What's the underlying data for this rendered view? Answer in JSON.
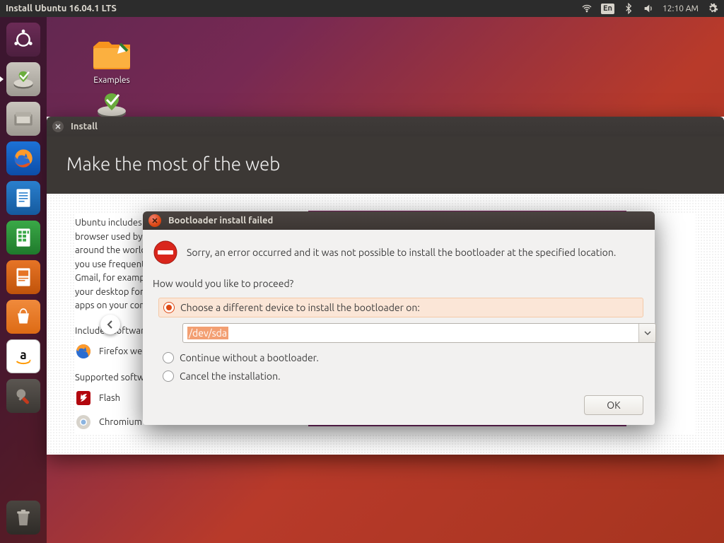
{
  "top_panel": {
    "title": "Install Ubuntu 16.04.1 LTS",
    "lang": "En",
    "clock": "12:10 AM"
  },
  "desktop": {
    "examples_label": "Examples"
  },
  "install_window": {
    "titlebar": "Install",
    "heading": "Make the most of the web",
    "blurb": "Ubuntu includes Firefox, the web browser used by millions of people around the world. And web applications you use frequently (like Facebook or Gmail, for example) can be pinned to your desktop for faster access, just like apps on your computer.",
    "included_label": "Included software",
    "included_items": [
      "Firefox web browser"
    ],
    "supported_label": "Supported software",
    "supported_items": [
      "Flash",
      "Chromium"
    ]
  },
  "dialog": {
    "title": "Bootloader install failed",
    "message": "Sorry, an error occurred and it was not possible to install the bootloader at the specified location.",
    "question": "How would you like to proceed?",
    "options": [
      "Choose a different device to install the bootloader on:",
      "Continue without a bootloader.",
      "Cancel the installation."
    ],
    "device_value": "/dev/sda",
    "ok_label": "OK"
  }
}
